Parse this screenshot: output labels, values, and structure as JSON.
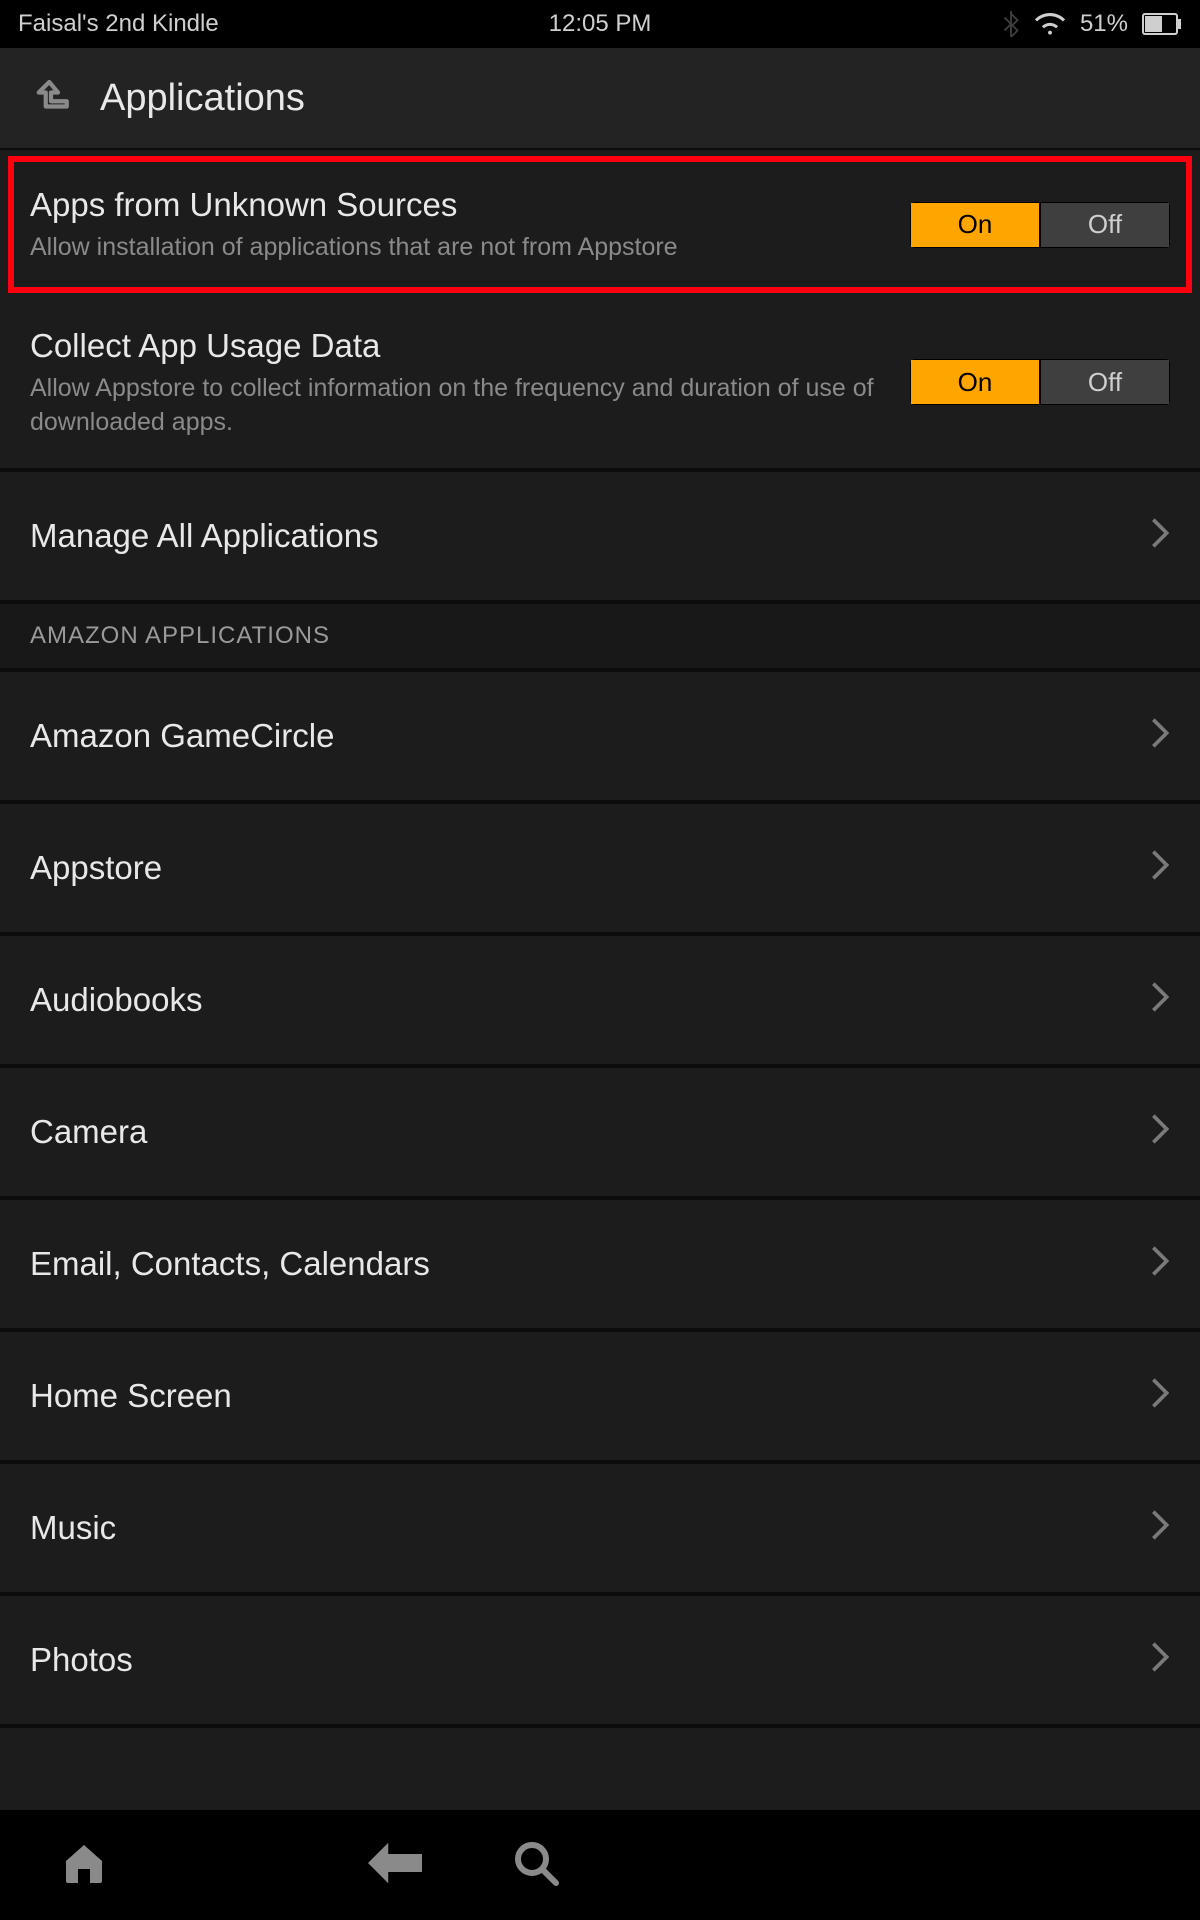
{
  "status": {
    "device_name": "Faisal's 2nd Kindle",
    "time": "12:05 PM",
    "battery": "51%"
  },
  "header": {
    "title": "Applications"
  },
  "settings": {
    "unknown_sources": {
      "title": "Apps from Unknown Sources",
      "subtitle": "Allow installation of applications that are not from Appstore",
      "on_label": "On",
      "off_label": "Off",
      "state": "On"
    },
    "usage_data": {
      "title": "Collect App Usage Data",
      "subtitle": "Allow Appstore to collect information on the frequency and duration of use of downloaded apps.",
      "on_label": "On",
      "off_label": "Off",
      "state": "On"
    },
    "manage_all": {
      "title": "Manage All Applications"
    }
  },
  "section": {
    "amazon_header": "AMAZON APPLICATIONS",
    "items": [
      {
        "label": "Amazon GameCircle"
      },
      {
        "label": "Appstore"
      },
      {
        "label": "Audiobooks"
      },
      {
        "label": "Camera"
      },
      {
        "label": "Email, Contacts, Calendars"
      },
      {
        "label": "Home Screen"
      },
      {
        "label": "Music"
      },
      {
        "label": "Photos"
      }
    ]
  },
  "colors": {
    "accent": "#ffa500",
    "highlight_box": "#ff0010"
  }
}
